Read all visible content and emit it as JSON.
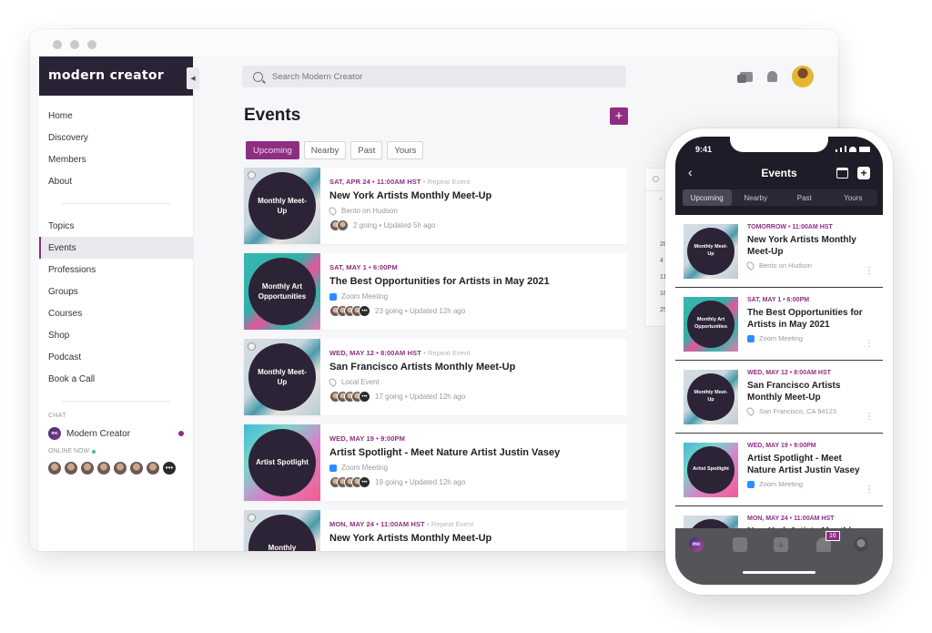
{
  "desktop": {
    "brand": "modern creator",
    "search": {
      "placeholder": "Search Modern Creator"
    },
    "page_title": "Events",
    "add_label": "+",
    "tabs": [
      {
        "label": "Upcoming",
        "active": true
      },
      {
        "label": "Nearby",
        "active": false
      },
      {
        "label": "Past",
        "active": false
      },
      {
        "label": "Yours",
        "active": false
      }
    ],
    "sidebar": {
      "primary": [
        "Home",
        "Discovery",
        "Members",
        "About"
      ],
      "secondary": [
        "Topics",
        "Events",
        "Professions",
        "Groups",
        "Courses",
        "Shop",
        "Podcast",
        "Book a Call"
      ],
      "active_item": "Events",
      "chat_label": "CHAT",
      "chat_name": "Modern Creator",
      "chat_logo": "mc",
      "online_label": "ONLINE NOW",
      "online_more": "•••"
    },
    "events": [
      {
        "thumb_text": "Monthly Meet-Up",
        "date": "SAT, APR 24 • 11:00AM HST",
        "repeat": " • Repeat Event",
        "title": "New York Artists Monthly Meet-Up",
        "location_icon": "pin-icon",
        "location": "Bento on Hudson",
        "meta": "2 going • Updated 5h ago"
      },
      {
        "thumb_text": "Monthly Art Opportunities",
        "date": "SAT, MAY 1 • 6:00PM",
        "repeat": "",
        "title": "The Best Opportunities for Artists in May 2021",
        "location_icon": "zoom-icon",
        "location": "Zoom Meeting",
        "meta": "23 going • Updated 12h ago"
      },
      {
        "thumb_text": "Monthly Meet-Up",
        "date": "WED, MAY 12 • 8:00AM HST",
        "repeat": " • Repeat Event",
        "title": "San Francisco Artists Monthly Meet-Up",
        "location_icon": "pin-icon",
        "location": "Local Event",
        "meta": "17 going • Updated 12h ago"
      },
      {
        "thumb_text": "Artist Spotlight",
        "date": "WED, MAY 19 • 9:00PM",
        "repeat": "",
        "title": "Artist Spotlight - Meet Nature Artist Justin Vasey",
        "location_icon": "zoom-icon",
        "location": "Zoom Meeting",
        "meta": "19 going • Updated 12h ago"
      },
      {
        "thumb_text": "Monthly",
        "date": "MON, MAY 24 • 11:00AM HST",
        "repeat": " • Repeat Event",
        "title": "New York Artists Monthly Meet-Up"
      }
    ],
    "calendar_numbers": [
      "28",
      "4",
      "11",
      "18",
      "25"
    ]
  },
  "phone": {
    "time": "9:41",
    "title": "Events",
    "back": "‹",
    "plus": "+",
    "tabs": [
      "Upcoming",
      "Nearby",
      "Past",
      "Yours"
    ],
    "events": [
      {
        "thumb_text": "Monthly Meet-Up",
        "date": "TOMORROW • 11:00AM HST",
        "title": "New York Artists Monthly Meet-Up",
        "location": "Bento on Hudson"
      },
      {
        "thumb_text": "Monthly Art Opportunities",
        "date": "SAT, MAY 1 • 6:00PM",
        "title": "The Best Opportunities for Artists in May 2021",
        "location": "Zoom Meeting"
      },
      {
        "thumb_text": "Monthly Meet-Up",
        "date": "WED, MAY 12 • 8:00AM HST",
        "title": "San Francisco Artists Monthly Meet-Up",
        "location": "San Francisco, CA 94123"
      },
      {
        "thumb_text": "Artist Spotlight",
        "date": "WED, MAY 19 • 9:00PM",
        "title": "Artist Spotlight - Meet Nature Artist Justin Vasey",
        "location": "Zoom Meeting"
      },
      {
        "thumb_text": "",
        "date": "MON, MAY 24 • 11:00AM HST",
        "title": "New York Artists Monthly"
      }
    ],
    "bottom_logo": "mc",
    "notification_badge": "16",
    "kebab": "⋮"
  },
  "colors": {
    "accent": "#8e2e83",
    "brand_dark": "#2a2235"
  }
}
